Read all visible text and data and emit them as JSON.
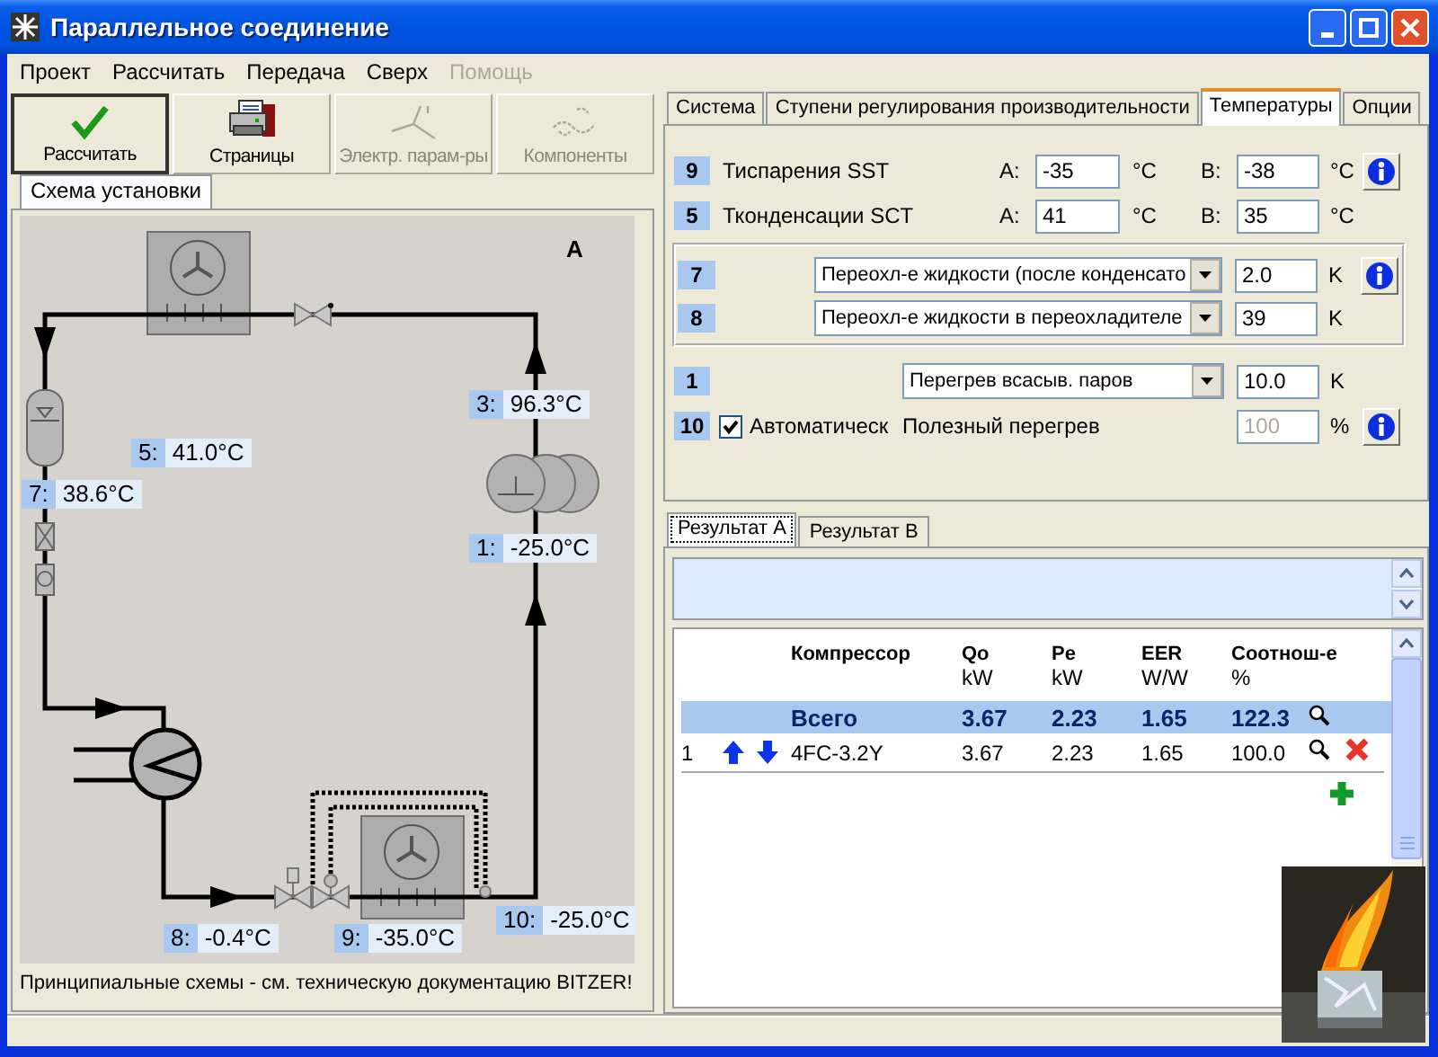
{
  "window": {
    "title": "Параллельное соединение"
  },
  "menu": [
    {
      "label": "Проект",
      "disabled": false
    },
    {
      "label": "Рассчитать",
      "disabled": false
    },
    {
      "label": "Передача",
      "disabled": false
    },
    {
      "label": "Сверх",
      "disabled": false
    },
    {
      "label": "Помощь",
      "disabled": true
    }
  ],
  "toolbar": [
    {
      "label": "Рассчитать",
      "disabled": false
    },
    {
      "label": "Страницы",
      "disabled": false
    },
    {
      "label": "Электр. парам-ры",
      "disabled": true
    },
    {
      "label": "Компоненты",
      "disabled": true
    }
  ],
  "schema": {
    "tabs": [
      {
        "label": "Схема установки",
        "selected": true
      }
    ],
    "circuit": "A",
    "points": [
      {
        "number": "5:",
        "value": "41.0°C"
      },
      {
        "number": "3:",
        "value": "96.3°C"
      },
      {
        "number": "7:",
        "value": "38.6°C"
      },
      {
        "number": "1:",
        "value": "-25.0°C"
      },
      {
        "number": "8:",
        "value": "-0.4°C"
      },
      {
        "number": "9:",
        "value": "-35.0°C"
      },
      {
        "number": "10:",
        "value": "-25.0°C"
      }
    ],
    "note": "Принципиальные схемы - см. техническую документацию BITZER!"
  },
  "settings": {
    "tabs": [
      {
        "label": "Система",
        "selected": false
      },
      {
        "label": "Ступени регулирования производительности",
        "selected": false
      },
      {
        "label": "Температуры",
        "selected": true
      },
      {
        "label": "Опции",
        "selected": false
      }
    ],
    "temperatures": [
      {
        "badge": "9",
        "label": "Тиспарения SST",
        "a_label": "A:",
        "a_value": "-35",
        "a_unit": "°C",
        "b_label": "B:",
        "b_value": "-38",
        "b_unit": "°C",
        "info": true
      },
      {
        "badge": "5",
        "label": "Тконденсации SCT",
        "a_label": "A:",
        "a_value": "41",
        "a_unit": "°C",
        "b_label": "B:",
        "b_value": "35",
        "b_unit": "°C",
        "info": false
      }
    ],
    "subcooling": [
      {
        "badge": "7",
        "option": "Переохл-е жидкости (после конденсато",
        "value": "2.0",
        "unit": "K",
        "info": true
      },
      {
        "badge": "8",
        "option": "Переохл-е жидкости в переохладителе",
        "value": "39",
        "unit": "K",
        "info": false
      }
    ],
    "superheat": {
      "badge": "1",
      "option": "Перегрев всасыв. паров",
      "value": "10.0",
      "unit": "K"
    },
    "useful_superheat": {
      "badge": "10",
      "auto_checked": true,
      "auto_label": "Автоматическ",
      "label": "Полезный перегрев",
      "value": "100",
      "disabled": true,
      "unit": "%",
      "info": true
    }
  },
  "results": {
    "tabs": [
      {
        "label": "Результат A",
        "selected": true
      },
      {
        "label": "Результат B",
        "selected": false
      }
    ],
    "columns": [
      {
        "title": "Компрессор"
      },
      {
        "title": "Qo",
        "unit": "kW"
      },
      {
        "title": "Pe",
        "unit": "kW"
      },
      {
        "title": "EER",
        "unit": "W/W"
      },
      {
        "title": "Соотнош-е",
        "unit": "%"
      }
    ],
    "rows": [
      {
        "kind": "total",
        "model": "Всего",
        "qo": "3.67",
        "pe": "2.23",
        "eer": "1.65",
        "ratio": "122.3"
      },
      {
        "kind": "compressor",
        "index": "1",
        "model": "4FC-3.2Y",
        "qo": "3.67",
        "pe": "2.23",
        "eer": "1.65",
        "ratio": "100.0"
      }
    ]
  }
}
